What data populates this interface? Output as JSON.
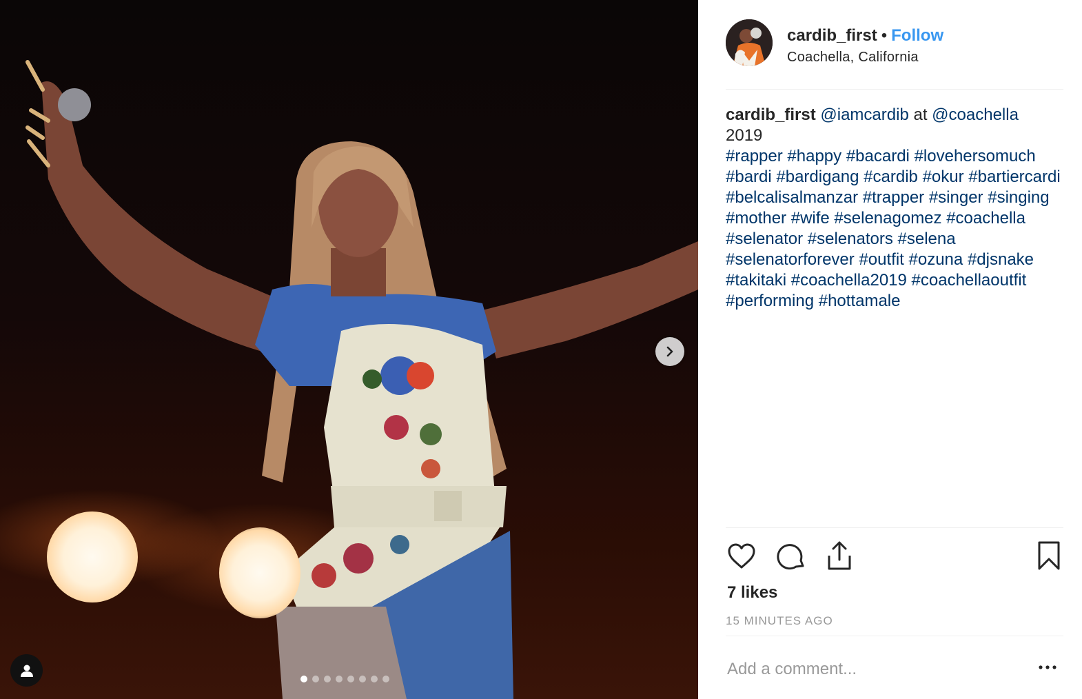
{
  "post": {
    "username": "cardib_first",
    "separator": "•",
    "follow_label": "Follow",
    "location": "Coachella, California"
  },
  "caption": {
    "username": "cardib_first",
    "mention1": "@iamcardib",
    "word_at": "at",
    "mention2": "@coachella",
    "year": "2019",
    "hashtags": [
      "#rapper",
      "#happy",
      "#bacardi",
      "#lovehersomuch",
      "#bardi",
      "#bardigang",
      "#cardib",
      "#okur",
      "#bartiercardi",
      "#belcalisalmanzar",
      "#trapper",
      "#singer",
      "#singing",
      "#mother",
      "#wife",
      "#selenagomez",
      "#coachella",
      "#selenator",
      "#selenators",
      "#selena",
      "#selenatorforever",
      "#outfit",
      "#ozuna",
      "#djsnake",
      "#takitaki",
      "#coachella2019",
      "#coachellaoutfit",
      "#performing",
      "#hottamale"
    ]
  },
  "stats": {
    "likes": "7 likes",
    "time": "15 MINUTES AGO"
  },
  "comment": {
    "placeholder": "Add a comment..."
  },
  "media": {
    "carousel": {
      "count": 8,
      "active_index": 0
    }
  },
  "icons": {
    "like": "heart-icon",
    "comment": "comment-bubble-icon",
    "share": "share-icon",
    "save": "bookmark-icon",
    "more": "more-options-icon",
    "next": "chevron-right-icon",
    "tag": "person-tag-icon"
  },
  "colors": {
    "follow": "#3897f0",
    "hashtag": "#003569",
    "muted": "#999999",
    "text": "#262626"
  }
}
